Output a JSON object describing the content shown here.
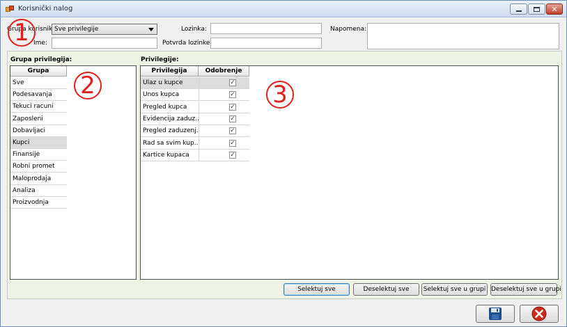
{
  "window": {
    "title": "Korisnički nalog"
  },
  "form": {
    "grupa_label": "Grupa korisnika:",
    "grupa_value": "Sve privilegije",
    "ime_label": "Ime:",
    "ime_value": "",
    "lozinka_label": "Lozinka:",
    "lozinka_value": "",
    "potvrda_label": "Potvrda lozinke:",
    "potvrda_value": "",
    "napomena_label": "Napomena:",
    "napomena_value": ""
  },
  "callouts": [
    "1",
    "2",
    "3"
  ],
  "groups_panel": {
    "title": "Grupa privilegija:",
    "column": "Grupa",
    "selected_index": 5,
    "items": [
      "Sve",
      "Podesavanja",
      "Tekuci racuni",
      "Zaposleni",
      "Dobavljaci",
      "Kupci",
      "Finansije",
      "Robni promet",
      "Maloprodaja",
      "Analiza",
      "Proizvodnja"
    ]
  },
  "privileges_panel": {
    "title": "Privilegije:",
    "columns": [
      "Privilegija",
      "Odobrenje"
    ],
    "rows": [
      {
        "name": "Ulaz u kupce",
        "approved": true
      },
      {
        "name": "Unos kupca",
        "approved": true
      },
      {
        "name": "Pregled kupca",
        "approved": true
      },
      {
        "name": "Evidencija zaduz...",
        "approved": true
      },
      {
        "name": "Pregled zaduzenj...",
        "approved": true
      },
      {
        "name": "Rad sa svim kup...",
        "approved": true
      },
      {
        "name": "Kartice kupaca",
        "approved": true
      }
    ]
  },
  "buttons": {
    "select_all": "Selektuj sve",
    "deselect_all": "Deselektuj sve",
    "select_all_group": "Selektuj sve u grupi",
    "deselect_all_group": "Deselektuj sve u grupi"
  },
  "icons": {
    "save": "floppy-disk-icon",
    "cancel": "cancel-x-icon"
  },
  "colors": {
    "callout": "#e0201c",
    "group_area": "#eef3e6",
    "cancel_red": "#cc2a1c",
    "save_blue": "#1f4f8f"
  }
}
